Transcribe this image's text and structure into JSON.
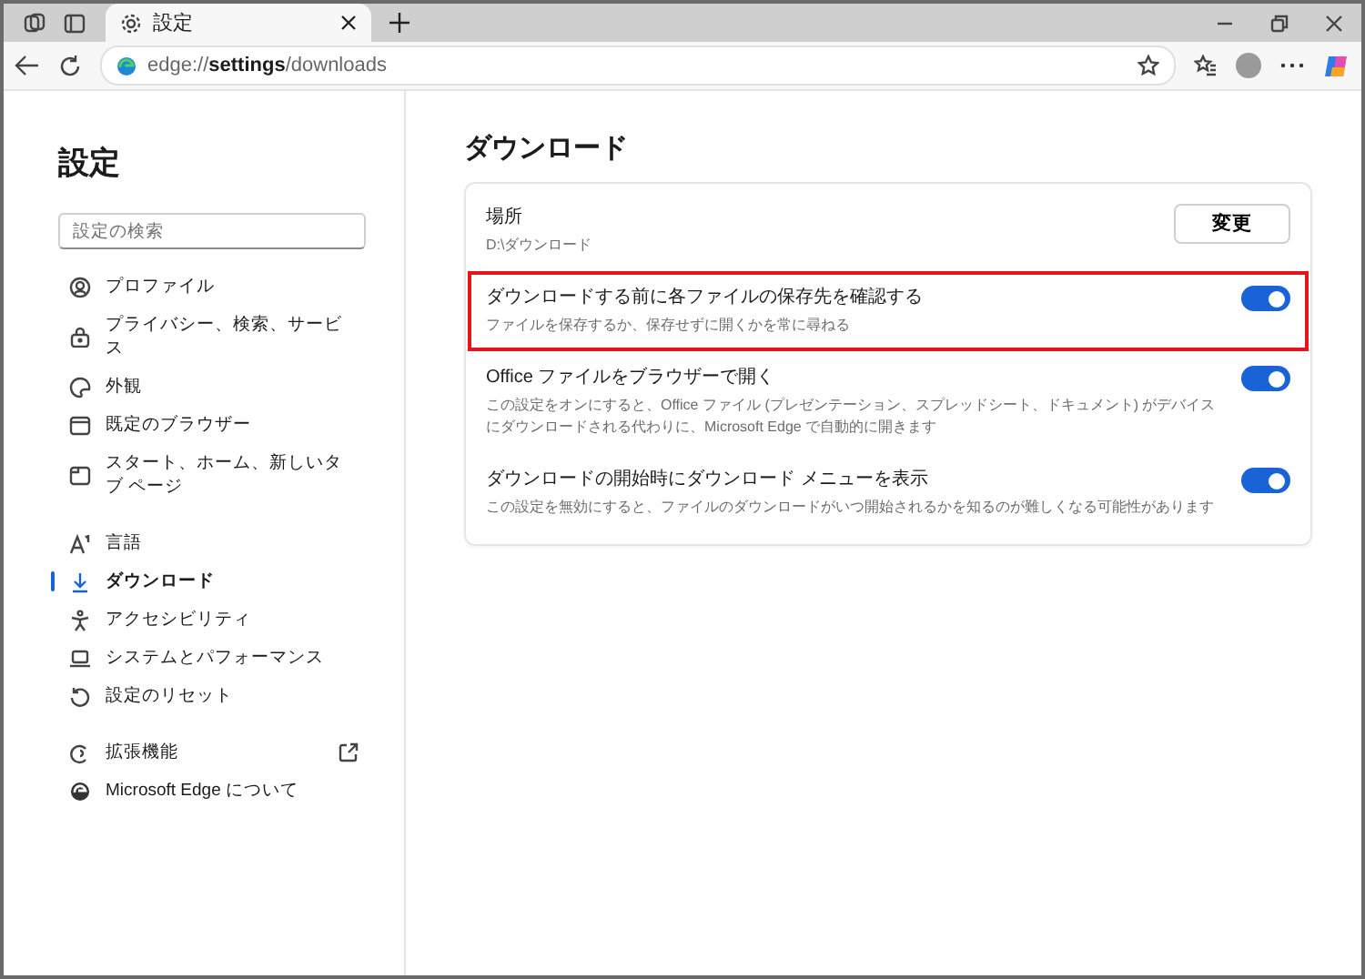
{
  "browser": {
    "tab": {
      "title": "設定",
      "selected": true
    },
    "address": "edge://**settings**/downloads"
  },
  "sidebar": {
    "title": "設定",
    "search": {
      "placeholder": "設定の検索"
    },
    "groups": [
      [
        {
          "label": "プロファイル",
          "selected": false
        },
        {
          "label": "プライバシー、検索、サービス",
          "selected": false
        },
        {
          "label": "外観",
          "selected": false
        },
        {
          "label": "既定のブラウザー",
          "selected": false
        },
        {
          "label": "スタート、ホーム、新しいタブ ページ",
          "selected": false
        }
      ],
      [
        {
          "label": "言語",
          "selected": false
        },
        {
          "label": "ダウンロード",
          "selected": true
        },
        {
          "label": "アクセシビリティ",
          "selected": false
        },
        {
          "label": "システムとパフォーマンス",
          "selected": false
        },
        {
          "label": "設定のリセット",
          "selected": false
        }
      ],
      [
        {
          "label": "拡張機能",
          "selected": false,
          "external": true
        },
        {
          "label": "Microsoft Edge について",
          "selected": false,
          "external": false
        }
      ]
    ]
  },
  "main": {
    "title": "ダウンロード",
    "location": {
      "label": "場所",
      "path": "D:\\ダウンロード",
      "button": "変更"
    },
    "settings": [
      {
        "title": "ダウンロードする前に各ファイルの保存先を確認する",
        "description": "ファイルを保存するか、保存せずに開くかを常に尋ねる",
        "on": true,
        "highlighted": true
      },
      {
        "title": "Office ファイルをブラウザーで開く",
        "description": "この設定をオンにすると、Office ファイル (プレゼンテーション、スプレッドシート、ドキュメント) がデバイスにダウンロードされる代わりに、Microsoft Edge で自動的に開きます",
        "on": true,
        "highlighted": false
      },
      {
        "title": "ダウンロードの開始時にダウンロード メニューを表示",
        "description": "この設定を無効にすると、ファイルのダウンロードがいつ開始されるかを知るのが難しくなる可能性があります",
        "on": true,
        "highlighted": false
      }
    ]
  }
}
